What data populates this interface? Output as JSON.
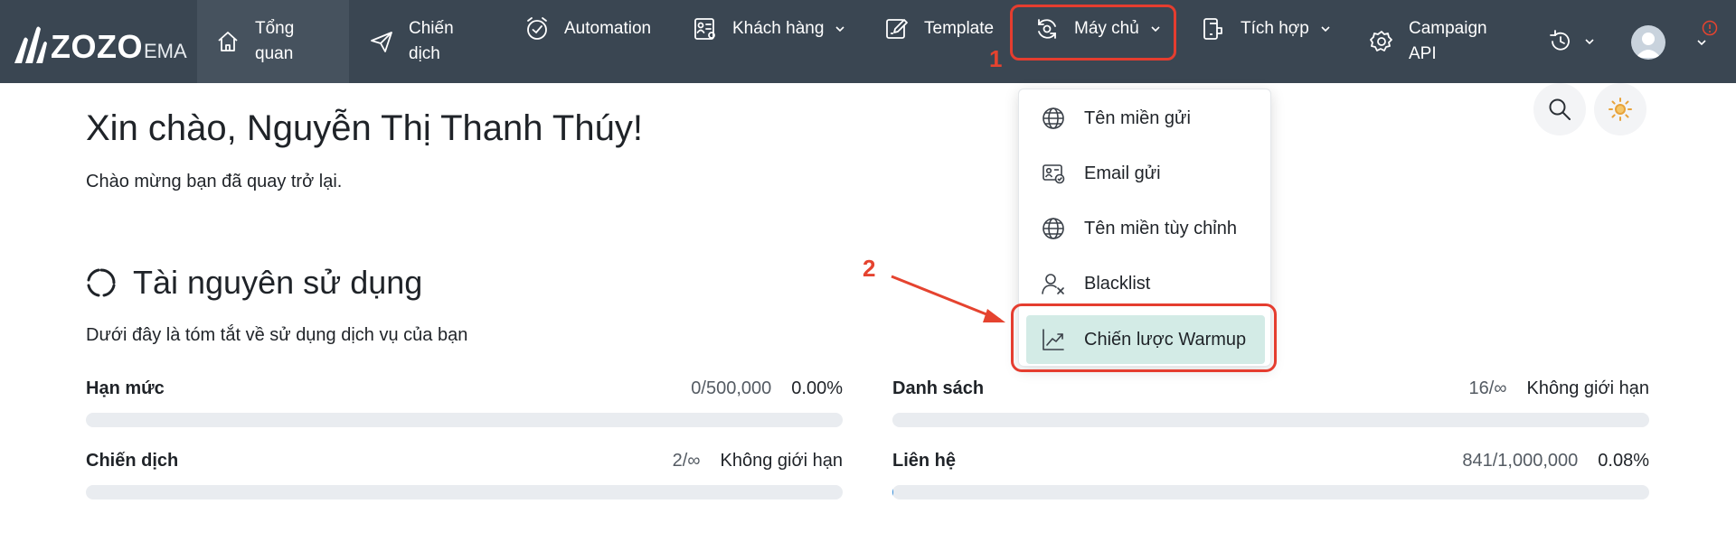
{
  "brand": {
    "name": "ZOZO",
    "suffix": "EMA"
  },
  "nav": {
    "overview": "Tổng quan",
    "campaign": "Chiến dịch",
    "automation": "Automation",
    "customers": "Khách hàng",
    "template": "Template",
    "server": "Máy chủ",
    "integration": "Tích hợp",
    "campaign_api": "Campaign API"
  },
  "annotations": {
    "step1": "1",
    "step2": "2"
  },
  "greeting": "Xin chào, Nguyễn Thị Thanh Thúy!",
  "welcome": "Chào mừng bạn đã quay trở lại.",
  "resources": {
    "title": "Tài nguyên sử dụng",
    "description": "Dưới đây là tóm tắt về sử dụng dịch vụ của bạn",
    "items": [
      {
        "label": "Hạn mức",
        "usage": "0/500,000",
        "percent": "0.00%",
        "fill": 0.0
      },
      {
        "label": "Danh sách",
        "usage": "16/∞",
        "percent": "Không giới hạn",
        "fill": 0.0
      },
      {
        "label": "Chiến dịch",
        "usage": "2/∞",
        "percent": "Không giới hạn",
        "fill": 0.0
      },
      {
        "label": "Liên hệ",
        "usage": "841/1,000,000",
        "percent": "0.08%",
        "fill": 0.0008
      }
    ]
  },
  "dropdown": {
    "items": [
      {
        "label": "Tên miền gửi",
        "icon": "globe-icon"
      },
      {
        "label": "Email gửi",
        "icon": "email-verified-icon"
      },
      {
        "label": "Tên miền tùy chỉnh",
        "icon": "globe-icon"
      },
      {
        "label": "Blacklist",
        "icon": "user-x-icon"
      },
      {
        "label": "Chiến lược Warmup",
        "icon": "chart-up-icon"
      }
    ],
    "selected_index": 4
  },
  "colors": {
    "topbar": "#3a4652",
    "accent_red": "#e53d2f",
    "selected_item": "#d3ebe6",
    "progress_track": "#e9ecf0",
    "progress_fill": "#3a8fd9"
  }
}
